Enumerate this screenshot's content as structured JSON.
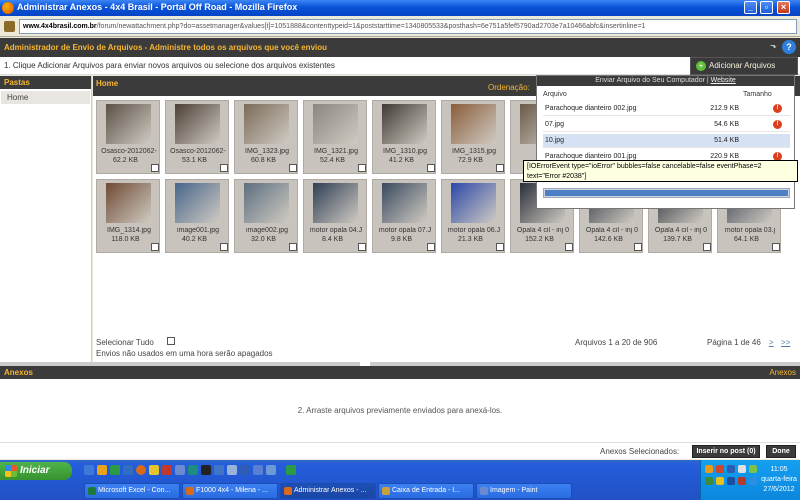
{
  "window": {
    "title": "Administrar Anexos - 4x4 Brasil - Portal Off Road - Mozilla Firefox",
    "url_domain": "www.4x4brasil.com.br",
    "url_rest": "/forum/newattachment.php?do=assetmanager&values[t]=1051888&contenttypeid=1&poststarttime=1340805533&posthash=6e751a5fef5790ad2703e7a10466abfc&insertinline=1"
  },
  "header": {
    "title": "Administrador de Envio de Arquivos - Administre todos os arquivos que você enviou"
  },
  "instructions": {
    "step1": "1. Clique Adicionar Arquivos para enviar novos arquivos ou selecione dos arquivos existentes",
    "add_button": "Adicionar Arquivos"
  },
  "folders": {
    "heading": "Pastas",
    "items": [
      {
        "label": "Home"
      }
    ]
  },
  "files": {
    "breadcrumb": "Home",
    "sort_label": "Ordenação:",
    "items": [
      {
        "name": "Osasco-2012062-",
        "size": "62.2 KB",
        "color": "#5b5146"
      },
      {
        "name": "Osasco-2012062-",
        "size": "53.1 KB",
        "color": "#4c4036"
      },
      {
        "name": "IMG_1323.jpg",
        "size": "60.8 KB",
        "color": "#7b6b58"
      },
      {
        "name": "IMG_1321.jpg",
        "size": "52.4 KB",
        "color": "#8a8780"
      },
      {
        "name": "IMG_1310.jpg",
        "size": "41.2 KB",
        "color": "#3f3a33"
      },
      {
        "name": "IMG_1315.jpg",
        "size": "72.9 KB",
        "color": "#8a5d3a"
      },
      {
        "name": "IMG",
        "size": "",
        "color": "#6a5a48"
      },
      {
        "name": "IMG_1314.jpg",
        "size": "118.0 KB",
        "color": "#6f4b33"
      },
      {
        "name": "image001.jpg",
        "size": "40.2 KB",
        "color": "#47658a"
      },
      {
        "name": "image002.jpg",
        "size": "32.0 KB",
        "color": "#5d6f7f"
      },
      {
        "name": "motor opala 04.J",
        "size": "8.4 KB",
        "color": "#2f3f55"
      },
      {
        "name": "motor opala 07.J",
        "size": "9.8 KB",
        "color": "#3a4a5e"
      },
      {
        "name": "motor opala 06.J",
        "size": "21.3 KB",
        "color": "#2c48a8"
      },
      {
        "name": "Opala 4 cil - inj 0",
        "size": "152.2 KB",
        "color": "#2a2f3a"
      },
      {
        "name": "Opala 4 cil - inj 0",
        "size": "142.6 KB",
        "color": "#343a45"
      },
      {
        "name": "Opala 4 cil - inj 0",
        "size": "139.7 KB",
        "color": "#2e333d"
      },
      {
        "name": "motor opala 03.j",
        "size": "64.1 KB",
        "color": "#3d4553"
      }
    ],
    "select_all": "Selecionar Tudo",
    "unused_note": "Envios não usados em uma hora serão apagados",
    "range_text": "Arquivos 1 a 20 de 906",
    "page_text": "Página 1 de 46",
    "next": ">",
    "last": ">>"
  },
  "upload_popup": {
    "title": "Enviar Arquivo do Seu Computador",
    "website_link": "Website",
    "col_file": "Arquivo",
    "col_size": "Tamanho",
    "rows": [
      {
        "name": "Parachoque dianteiro 002.jpg",
        "size": "212.9 KB",
        "error": true
      },
      {
        "name": "07.jpg",
        "size": "54.6 KB",
        "error": true
      },
      {
        "name": "10.jpg",
        "size": "51.4 KB",
        "error": false
      },
      {
        "name": "Parachoque dianteiro 001.jpg",
        "size": "220.9 KB",
        "error": true
      }
    ],
    "error_glyph": "!",
    "progress": 1.0,
    "error_tooltip": "[IOErrorEvent type=\"ioError\" bubbles=false cancelable=false eventPhase=2 text=\"Error #2038\"]"
  },
  "attachments": {
    "heading": "Anexos",
    "heading_right": "Anexos",
    "drag_hint": "2. Arraste arquivos previamente enviados para anexá-los.",
    "selected_label": "Anexos Selecionados:",
    "insert_button": "Inserir no post (0)",
    "done_button": "Done"
  },
  "taskbar": {
    "start": "Iniciar",
    "tasks": [
      {
        "label": "Microsoft Excel - Con...",
        "color": "#1E7A3A"
      },
      {
        "label": "F1000 4x4 - Milena - ...",
        "color": "#D86A1A"
      },
      {
        "label": "Administrar Anexos - ...",
        "color": "#D86A1A",
        "active": true
      },
      {
        "label": "Caixa de Entrada - I...",
        "color": "#C9A13B"
      },
      {
        "label": "Imagem - Paint",
        "color": "#6A8BD0"
      }
    ],
    "time": "11:05",
    "day": "quarta-feira",
    "date": "27/6/2012"
  },
  "colors": {
    "accent": "#F7B631",
    "dark": "#3B3B3B",
    "error": "#D9411E"
  }
}
